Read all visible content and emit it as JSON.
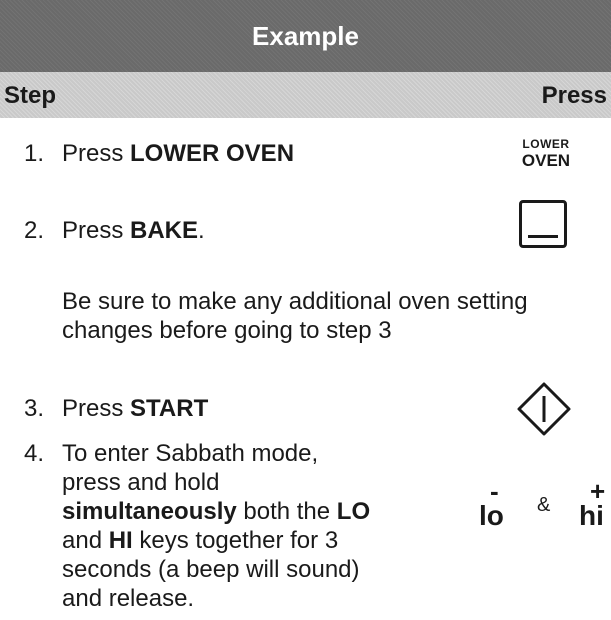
{
  "title": "Example",
  "header": {
    "step": "Step",
    "press": "Press"
  },
  "steps": [
    {
      "num": "1.",
      "text": "Press ",
      "bold": "LOWER OVEN",
      "after": ""
    },
    {
      "num": "2.",
      "text": "Press ",
      "bold": "BAKE",
      "after": "."
    },
    {
      "num": "3.",
      "text": "Press ",
      "bold": "START",
      "after": ""
    }
  ],
  "note": {
    "line1": "Be sure to make any additional oven setting",
    "line2": "changes before going to step 3"
  },
  "step4": {
    "num": "4.",
    "t1": "To enter Sabbath mode, press and hold ",
    "bold1": "simultaneously",
    "t2": " both the ",
    "bold2": "LO",
    "t3": " and ",
    "bold3": "HI",
    "t4": " keys together for 3 seconds (a beep will sound) and release."
  },
  "keys": {
    "lower_oven_line1": "LOWER",
    "lower_oven_line2": "OVEN",
    "bake_icon": "bake-icon",
    "start_icon": "start-icon",
    "minus": "-",
    "plus": "+",
    "lo": "lo",
    "amp": "&",
    "hi": "hi"
  },
  "colors": {
    "title_bg": "#6a6a6a",
    "header_bg": "#c9c9c9",
    "text": "#1a1a1a"
  }
}
